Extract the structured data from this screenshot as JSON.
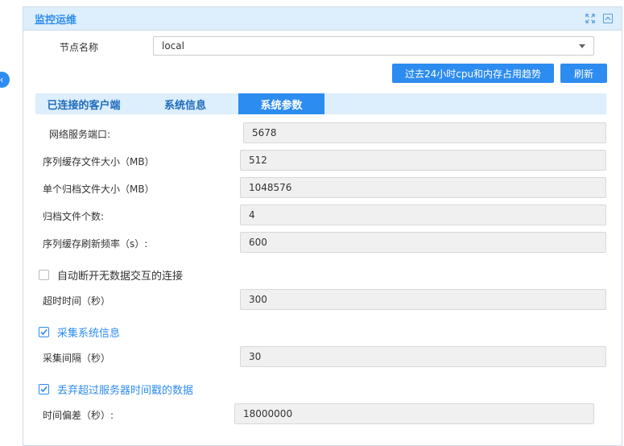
{
  "panel": {
    "title": "监控运维",
    "icons": [
      "expand-icon",
      "collapse-icon"
    ]
  },
  "node": {
    "label": "节点名称",
    "value": "local"
  },
  "buttons": {
    "trend": "过去24小时cpu和内存占用趋势",
    "refresh": "刷新"
  },
  "tabs": [
    {
      "label": "已连接的客户端",
      "active": false
    },
    {
      "label": "系统信息",
      "active": false
    },
    {
      "label": "系统参数",
      "active": true
    }
  ],
  "fields": {
    "port": {
      "label": "网络服务端口:",
      "value": "5678"
    },
    "seq_cache_size": {
      "label": "序列缓存文件大小（MB）",
      "value": "512"
    },
    "archive_size": {
      "label": "单个归档文件大小（MB）",
      "value": "1048576"
    },
    "archive_count": {
      "label": "归档文件个数:",
      "value": "4"
    },
    "seq_refresh": {
      "label": "序列缓存刷新频率（s）:",
      "value": "600"
    },
    "timeout": {
      "label": "超时时间（秒）",
      "value": "300"
    },
    "collect_interval": {
      "label": "采集间隔（秒）",
      "value": "30"
    },
    "time_offset": {
      "label": "时间偏差（秒）:",
      "value": "18000000"
    }
  },
  "checkboxes": {
    "auto_disconnect": {
      "label": "自动断开无数据交互的连接",
      "checked": false
    },
    "collect_sysinfo": {
      "label": "采集系统信息",
      "checked": true
    },
    "discard_data": {
      "label": "丢弃超过服务器时间戳的数据",
      "checked": true
    }
  },
  "colors": {
    "accent": "#2d8cf0",
    "header_bg": "#ddeefc",
    "input_bg": "#f0f0f0"
  }
}
